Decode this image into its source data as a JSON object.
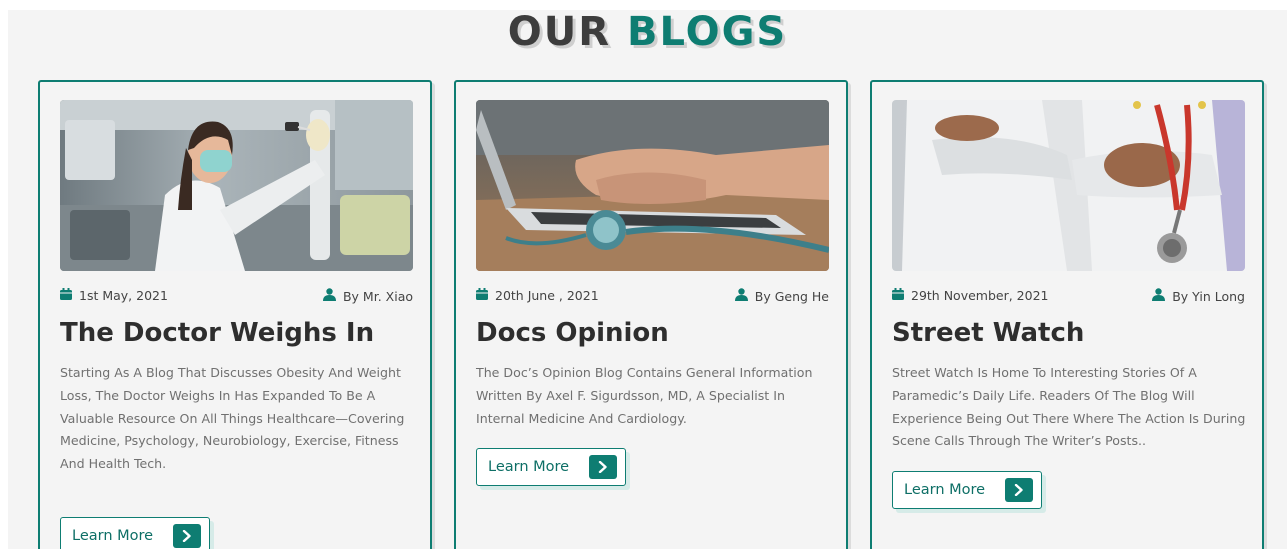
{
  "section": {
    "title_part1": "OUR",
    "title_part2": "BLOGS"
  },
  "colors": {
    "accent": "#0e7d72",
    "title_dark": "#3d3d3d",
    "text_dark": "#2e2e2e",
    "text_muted": "#707070"
  },
  "icons": {
    "date": "calendar-icon",
    "author": "user-icon",
    "button": "chevron-right-icon"
  },
  "cards": [
    {
      "image": "doctor-with-mask-lab-photo",
      "date": "1st May, 2021",
      "author": "By Mr. Xiao",
      "title": "The Doctor Weighs In",
      "description": "Starting As A Blog That Discusses Obesity And Weight Loss, The Doctor Weighs In Has Expanded To Be A Valuable Resource On All Things Healthcare—Covering Medicine, Psychology, Neurobiology, Exercise, Fitness And Health Tech.",
      "button_label": "Learn More"
    },
    {
      "image": "laptop-stethoscope-photo",
      "date": "20th June , 2021",
      "author": "By Geng He",
      "title": "Docs Opinion",
      "description": "The Doc’s Opinion Blog Contains General Information Written By Axel F. Sigurdsson, MD, A Specialist In Internal Medicine And Cardiology.",
      "button_label": "Learn More"
    },
    {
      "image": "doctor-arms-crossed-stethoscope-photo",
      "date": "29th November, 2021",
      "author": "By Yin Long",
      "title": "Street Watch",
      "description": "Street Watch Is Home To Interesting Stories Of A Paramedic’s Daily Life. Readers Of The Blog Will Experience Being Out There Where The Action Is During Scene Calls Through The Writer’s Posts..",
      "button_label": "Learn More"
    }
  ]
}
